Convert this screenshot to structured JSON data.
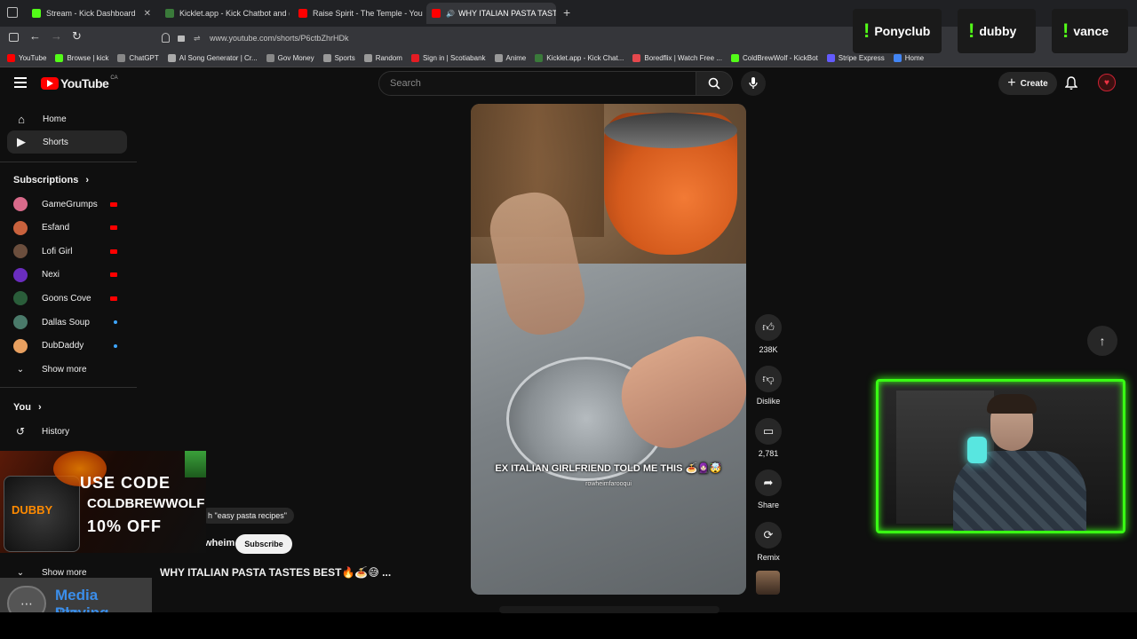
{
  "browser": {
    "tabs": [
      {
        "title": "Stream - Kick Dashboard",
        "color": "#53fc18"
      },
      {
        "title": "Kicklet.app - Kick Chatbot and (",
        "color": "#3a7a3a"
      },
      {
        "title": "Raise Spirit - The Temple - YouT",
        "color": "#ff0000"
      },
      {
        "title": "WHY ITALIAN PASTA TASTES",
        "color": "#ff0000"
      }
    ],
    "url": "www.youtube.com/shorts/P6ctbZhrHDk",
    "bookmarks": [
      {
        "label": "YouTube",
        "color": "#ff0000"
      },
      {
        "label": "Browse | kick",
        "color": "#53fc18"
      },
      {
        "label": "ChatGPT",
        "color": "#888888"
      },
      {
        "label": "AI Song Generator | Cr...",
        "color": "#aaaaaa"
      },
      {
        "label": "Gov Money",
        "color": "#888888"
      },
      {
        "label": "Sports",
        "color": "#999999"
      },
      {
        "label": "Random",
        "color": "#999999"
      },
      {
        "label": "Sign in | Scotiabank",
        "color": "#e41c23"
      },
      {
        "label": "Anime",
        "color": "#999999"
      },
      {
        "label": "Kicklet.app - Kick Chat...",
        "color": "#3a7a3a"
      },
      {
        "label": "Boredflix | Watch Free ...",
        "color": "#e5484d"
      },
      {
        "label": "ColdBrewWolf - KickBot",
        "color": "#53fc18"
      },
      {
        "label": "Stripe Express",
        "color": "#635bff"
      },
      {
        "label": "Home",
        "color": "#4285f4"
      }
    ]
  },
  "youtube": {
    "logo_text": "YouTube",
    "logo_region": "CA",
    "search_placeholder": "Search",
    "create_label": "Create",
    "sidebar": {
      "home": "Home",
      "shorts": "Shorts",
      "subscriptions_header": "Subscriptions",
      "subscriptions": [
        {
          "name": "GameGrumps",
          "color": "#d86a8a",
          "indicator": "live"
        },
        {
          "name": "Esfand",
          "color": "#c9623d",
          "indicator": "live"
        },
        {
          "name": "Lofi Girl",
          "color": "#6b4e3d",
          "indicator": "live"
        },
        {
          "name": "Nexi",
          "color": "#6a2dbf",
          "indicator": "live"
        },
        {
          "name": "Goons Cove",
          "color": "#2a5d3a",
          "indicator": "live"
        },
        {
          "name": "Dallas Soup",
          "color": "#4a7a6a",
          "indicator": "new"
        },
        {
          "name": "DubDaddy",
          "color": "#e8a060",
          "indicator": "new"
        }
      ],
      "show_more": "Show more",
      "you_header": "You",
      "history": "History",
      "show_more_2": "Show more"
    },
    "short": {
      "caption": "EX ITALIAN GIRLFRIEND TOLD ME THIS 🍝🧕🏻🤯",
      "caption_credit": "rowheimfarooqui",
      "title": "WHY ITALIAN PASTA TASTES BEST🔥🍝😅 ...",
      "search_chip": "h \"easy pasta recipes\"",
      "channel_fragment": "wheim",
      "subscribe_label": "Subscribe"
    },
    "actions": {
      "likes": "238K",
      "dislike": "Dislike",
      "comments": "2,781",
      "share": "Share",
      "remix": "Remix"
    }
  },
  "overlays": {
    "chat_tags": [
      {
        "label": "Ponyclub"
      },
      {
        "label": "dubby"
      },
      {
        "label": "vance"
      }
    ],
    "promo": {
      "line1": "USE CODE",
      "line2": "COLDBREWWOLF",
      "line3": "10% OFF",
      "brand": "DUBBY"
    },
    "media": {
      "title": "Media Playing",
      "subtitle": "None"
    },
    "webcam_border_color": "#39ff14"
  }
}
